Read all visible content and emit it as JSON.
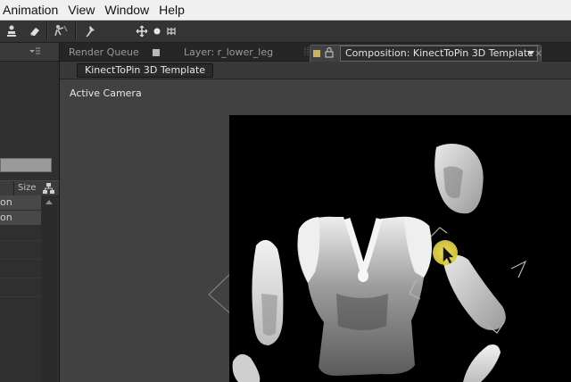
{
  "menubar": {
    "items": [
      "Animation",
      "View",
      "Window",
      "Help"
    ]
  },
  "toolbar": {
    "tools": [
      "puppet-pin-icon",
      "eraser-icon",
      "pen-icon",
      "puppet-starch-icon",
      "pin-tool-icon",
      "orbit-icon",
      "dot-icon",
      "grid-icon"
    ]
  },
  "left_panel": {
    "column_header": "Size",
    "rows": [
      "on",
      "on"
    ]
  },
  "panel_tabs": {
    "render_queue": "Render Queue",
    "layer": "Layer: r_lower_leg",
    "composition": "Composition: KinectToPin 3D Template"
  },
  "composition": {
    "breadcrumb": "KinectToPin 3D Template",
    "view_label": "Active Camera"
  },
  "colors": {
    "menubar_bg": "#f0f0f0",
    "panel_bg": "#414141",
    "cursor_highlight": "#f2e040"
  }
}
